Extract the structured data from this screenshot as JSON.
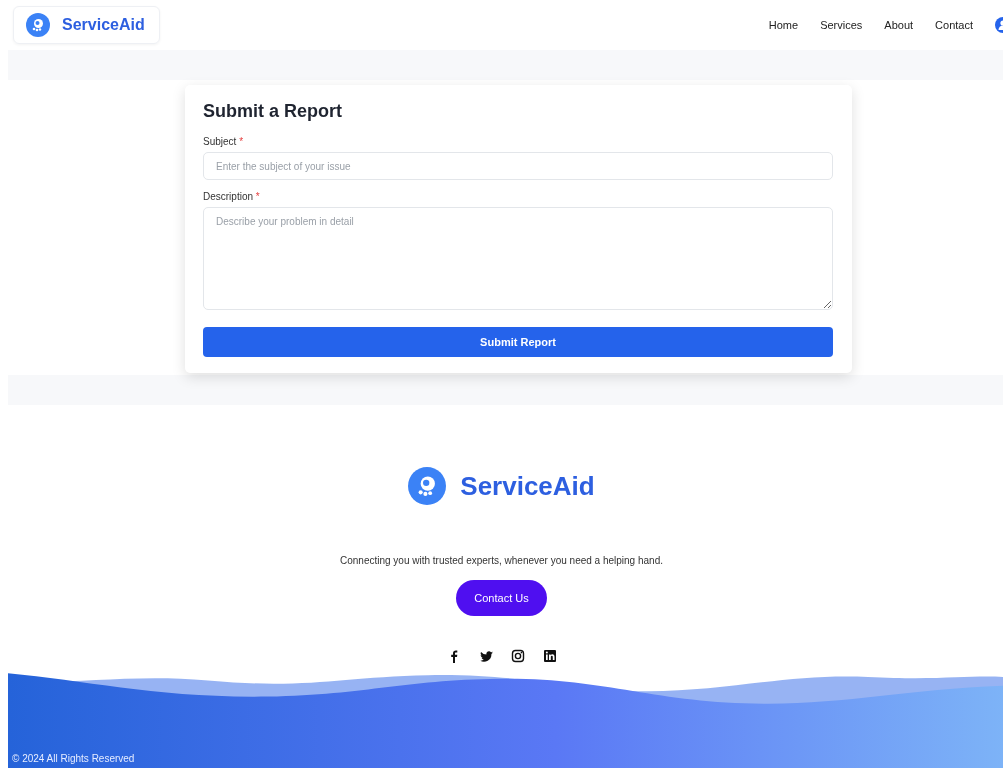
{
  "header": {
    "brand": "ServiceAid",
    "nav": [
      {
        "label": "Home"
      },
      {
        "label": "Services"
      },
      {
        "label": "About"
      },
      {
        "label": "Contact"
      }
    ]
  },
  "form": {
    "title": "Submit a Report",
    "fields": [
      {
        "kind": "input",
        "label": "Subject",
        "required_mark": "*",
        "placeholder": "Enter the subject of your issue"
      },
      {
        "kind": "textarea",
        "label": "Description",
        "required_mark": "*",
        "placeholder": "Describe your problem in detail"
      }
    ],
    "submit": "Submit Report"
  },
  "footer": {
    "brand": "ServiceAid",
    "tagline": "Connecting you with trusted experts, whenever you need a helping hand.",
    "button": "Contact Us",
    "social": [
      {
        "kind": "facebook"
      },
      {
        "kind": "twitter"
      },
      {
        "kind": "instagram"
      },
      {
        "kind": "linkedin"
      }
    ],
    "copyright": "© 2024 All Rights Reserved"
  }
}
